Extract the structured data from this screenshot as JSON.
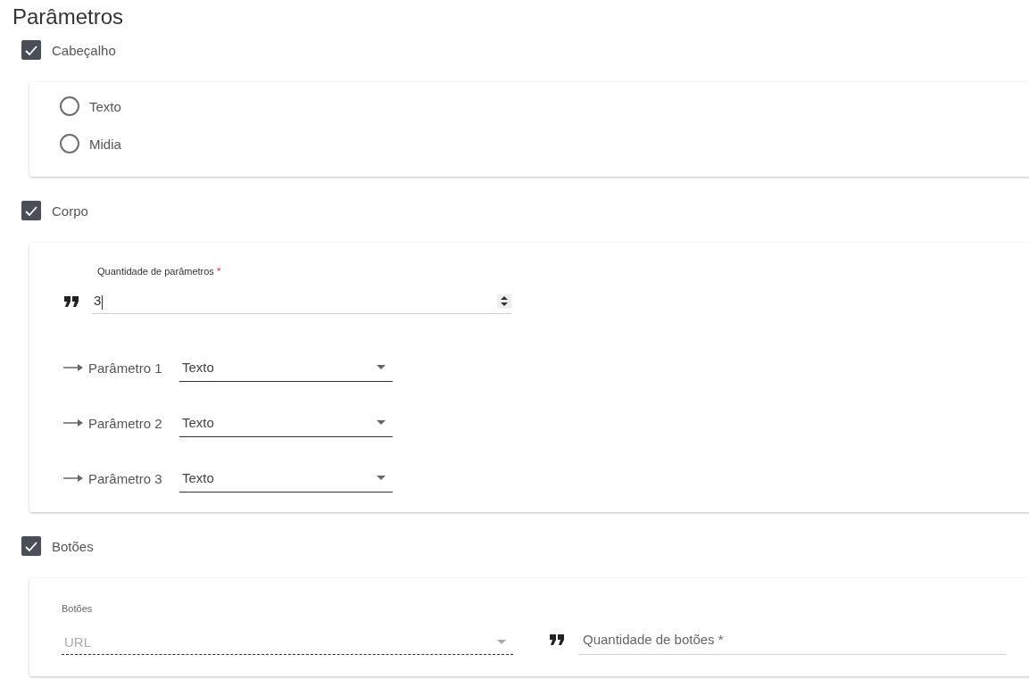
{
  "title": "Parâmetros",
  "sections": [
    {
      "kind": "radios",
      "label": "Cabeçalho",
      "checked": true,
      "options": [
        {
          "label": "Texto",
          "selected": false
        },
        {
          "label": "Midia",
          "selected": false
        }
      ]
    },
    {
      "kind": "params",
      "label": "Corpo",
      "checked": true,
      "count_field": {
        "label": "Quantidade de parâmetros",
        "required_mark": "*",
        "value": "3"
      },
      "params": [
        {
          "label": "Parâmetro 1",
          "value": "Texto"
        },
        {
          "label": "Parâmetro 2",
          "value": "Texto"
        },
        {
          "label": "Parâmetro 3",
          "value": "Texto"
        }
      ]
    },
    {
      "kind": "buttons",
      "label": "Botões",
      "checked": true,
      "type_select": {
        "label": "Botões",
        "value": "URL",
        "disabled": true
      },
      "count_field": {
        "placeholder": "Quantidade de botões *"
      }
    }
  ]
}
